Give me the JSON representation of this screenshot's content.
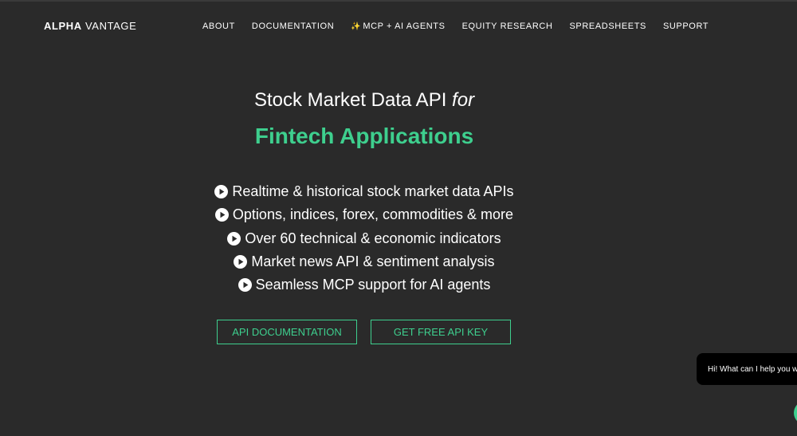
{
  "brand": {
    "logo_bold": "ALPHA",
    "logo_thin": "VANTAGE"
  },
  "nav": {
    "items": [
      {
        "label": "ABOUT"
      },
      {
        "label": "DOCUMENTATION"
      },
      {
        "label": "MCP + AI AGENTS",
        "icon": "sparkles-icon"
      },
      {
        "label": "EQUITY RESEARCH"
      },
      {
        "label": "SPREADSHEETS"
      },
      {
        "label": "SUPPORT"
      }
    ]
  },
  "hero": {
    "title_main": "Stock Market Data API",
    "title_em": "for",
    "subtitle": "Fintech Applications",
    "features": [
      "Realtime & historical stock market data APIs",
      "Options, indices, forex, commodities & more",
      "Over 60 technical & economic indicators",
      "Market news API & sentiment analysis",
      "Seamless MCP support for AI agents"
    ]
  },
  "buttons": {
    "docs_label": "API DOCUMENTATION",
    "key_label": "GET FREE API KEY"
  },
  "chat": {
    "greeting": "Hi! What can I help you w"
  },
  "colors": {
    "background": "#2a2a2a",
    "accent": "#3ecf8e",
    "text": "#ffffff"
  }
}
